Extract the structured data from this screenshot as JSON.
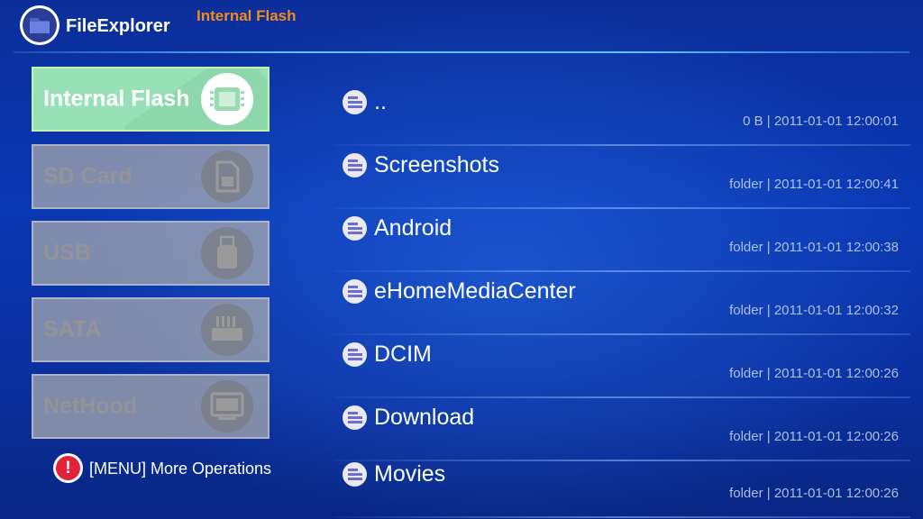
{
  "app": {
    "title": "FileExplorer",
    "location": "Internal Flash",
    "logo_icon": "folder-icon"
  },
  "storage": [
    {
      "label": "Internal Flash",
      "icon": "memory-chip-icon",
      "active": true
    },
    {
      "label": "SD Card",
      "icon": "sd-card-icon",
      "active": false
    },
    {
      "label": "USB",
      "icon": "usb-icon",
      "active": false
    },
    {
      "label": "SATA",
      "icon": "sata-icon",
      "active": false
    },
    {
      "label": "NetHood",
      "icon": "monitor-icon",
      "active": false
    }
  ],
  "menu_hint": {
    "icon_text": "!",
    "text": "[MENU] More Operations"
  },
  "files": [
    {
      "name": "..",
      "meta": "0 B | 2011-01-01 12:00:01"
    },
    {
      "name": "Screenshots",
      "meta": "folder | 2011-01-01 12:00:41"
    },
    {
      "name": "Android",
      "meta": "folder | 2011-01-01 12:00:38"
    },
    {
      "name": "eHomeMediaCenter",
      "meta": "folder | 2011-01-01 12:00:32"
    },
    {
      "name": "DCIM",
      "meta": "folder | 2011-01-01 12:00:26"
    },
    {
      "name": "Download",
      "meta": "folder | 2011-01-01 12:00:26"
    },
    {
      "name": "Movies",
      "meta": "folder | 2011-01-01 12:00:26"
    }
  ],
  "colors": {
    "background": "#0a37b4",
    "location_title": "#f08a22",
    "active_storage": "#98e1b6",
    "inactive_storage": "#afafaf",
    "divider": "#5cc1ff",
    "alert": "#e4233a"
  }
}
